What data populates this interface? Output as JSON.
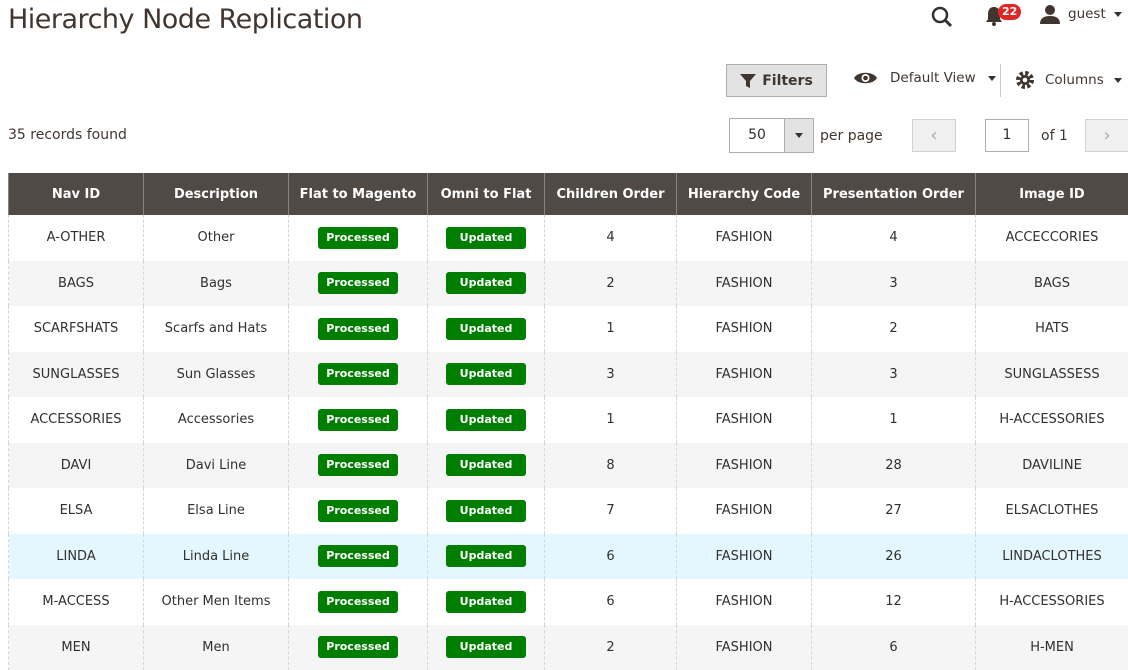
{
  "header": {
    "title": "Hierarchy Node Replication",
    "notifications": "22",
    "user": "guest"
  },
  "toolbar": {
    "filters": "Filters",
    "view": "Default View",
    "columns": "Columns",
    "records": "35 records found",
    "per_page_value": "50",
    "per_page_label": "per page",
    "page": "1",
    "of_pages": "of 1"
  },
  "table": {
    "columns": [
      "Nav ID",
      "Description",
      "Flat to Magento",
      "Omni to Flat",
      "Children Order",
      "Hierarchy Code",
      "Presentation Order",
      "Image ID"
    ],
    "rows": [
      [
        "A-OTHER",
        "Other",
        "Processed",
        "Updated",
        "4",
        "FASHION",
        "4",
        "ACCECCORIES"
      ],
      [
        "BAGS",
        "Bags",
        "Processed",
        "Updated",
        "2",
        "FASHION",
        "3",
        "BAGS"
      ],
      [
        "SCARFSHATS",
        "Scarfs and Hats",
        "Processed",
        "Updated",
        "1",
        "FASHION",
        "2",
        "HATS"
      ],
      [
        "SUNGLASSES",
        "Sun Glasses",
        "Processed",
        "Updated",
        "3",
        "FASHION",
        "3",
        "SUNGLASSESS"
      ],
      [
        "ACCESSORIES",
        "Accessories",
        "Processed",
        "Updated",
        "1",
        "FASHION",
        "1",
        "H-ACCESSORIES"
      ],
      [
        "DAVI",
        "Davi Line",
        "Processed",
        "Updated",
        "8",
        "FASHION",
        "28",
        "DAVILINE"
      ],
      [
        "ELSA",
        "Elsa Line",
        "Processed",
        "Updated",
        "7",
        "FASHION",
        "27",
        "ELSACLOTHES"
      ],
      [
        "LINDA",
        "Linda Line",
        "Processed",
        "Updated",
        "6",
        "FASHION",
        "26",
        "LINDACLOTHES"
      ],
      [
        "M-ACCESS",
        "Other Men Items",
        "Processed",
        "Updated",
        "6",
        "FASHION",
        "12",
        "H-ACCESSORIES"
      ],
      [
        "MEN",
        "Men",
        "Processed",
        "Updated",
        "2",
        "FASHION",
        "6",
        "H-MEN"
      ]
    ]
  }
}
